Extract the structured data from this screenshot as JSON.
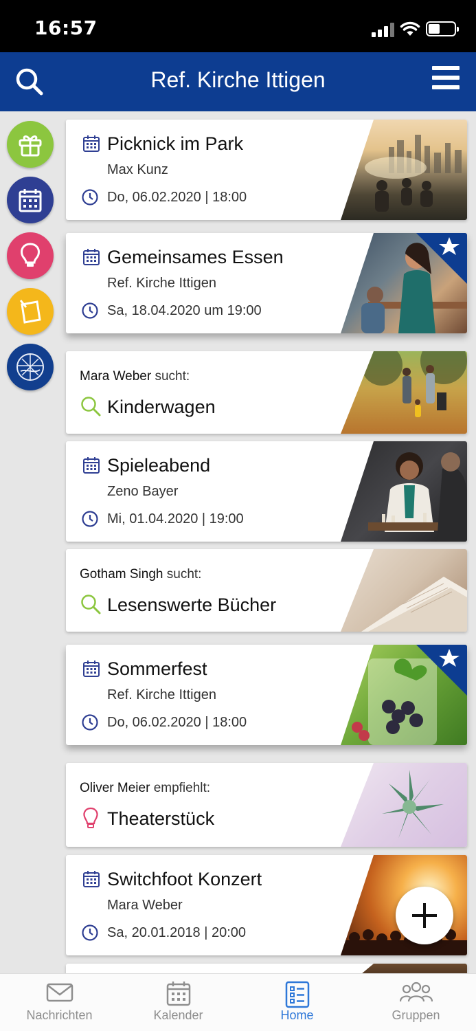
{
  "status_bar": {
    "time": "16:57"
  },
  "header": {
    "title": "Ref. Kirche Ittigen"
  },
  "categories": [
    {
      "name": "gift",
      "color": "#8cc63f"
    },
    {
      "name": "calendar",
      "color": "#2f3f93"
    },
    {
      "name": "idea",
      "color": "#e0406d"
    },
    {
      "name": "note",
      "color": "#f4b71b"
    },
    {
      "name": "church-logo",
      "color": "#123f8e"
    }
  ],
  "feed": [
    {
      "type": "event",
      "title": "Picknick im Park",
      "subtitle": "Max Kunz",
      "date": "Do, 06.02.2020 | 18:00",
      "starred": false
    },
    {
      "type": "event",
      "title": "Gemeinsames Essen",
      "subtitle": "Ref. Kirche Ittigen",
      "date": "Sa, 18.04.2020 um 19:00",
      "starred": true
    },
    {
      "type": "search",
      "person": "Mara Weber",
      "verb": "sucht:",
      "title": "Kinderwagen"
    },
    {
      "type": "event",
      "title": "Spieleabend",
      "subtitle": "Zeno Bayer",
      "date": "Mi, 01.04.2020 | 19:00",
      "starred": false
    },
    {
      "type": "search",
      "person": "Gotham Singh",
      "verb": "sucht:",
      "title": "Lesenswerte Bücher"
    },
    {
      "type": "event",
      "title": "Sommerfest",
      "subtitle": "Ref. Kirche Ittigen",
      "date": "Do, 06.02.2020 | 18:00",
      "starred": true
    },
    {
      "type": "recommend",
      "person": "Oliver Meier",
      "verb": "empfiehlt:",
      "title": "Theaterstück"
    },
    {
      "type": "event",
      "title": "Switchfoot Konzert",
      "subtitle": "Mara Weber",
      "date": "Sa, 20.01.2018 | 20:00",
      "starred": false
    }
  ],
  "tabbar": {
    "items": [
      {
        "label": "Nachrichten",
        "icon": "envelope-icon"
      },
      {
        "label": "Kalender",
        "icon": "calendar-icon"
      },
      {
        "label": "Home",
        "icon": "list-icon"
      },
      {
        "label": "Gruppen",
        "icon": "people-icon"
      }
    ],
    "active": "Home"
  },
  "colors": {
    "brand": "#0d3d91",
    "event_icon": "#2f3f93",
    "search_icon": "#8cc63f",
    "idea_icon": "#e0406d",
    "active_tab": "#2d77d8"
  }
}
